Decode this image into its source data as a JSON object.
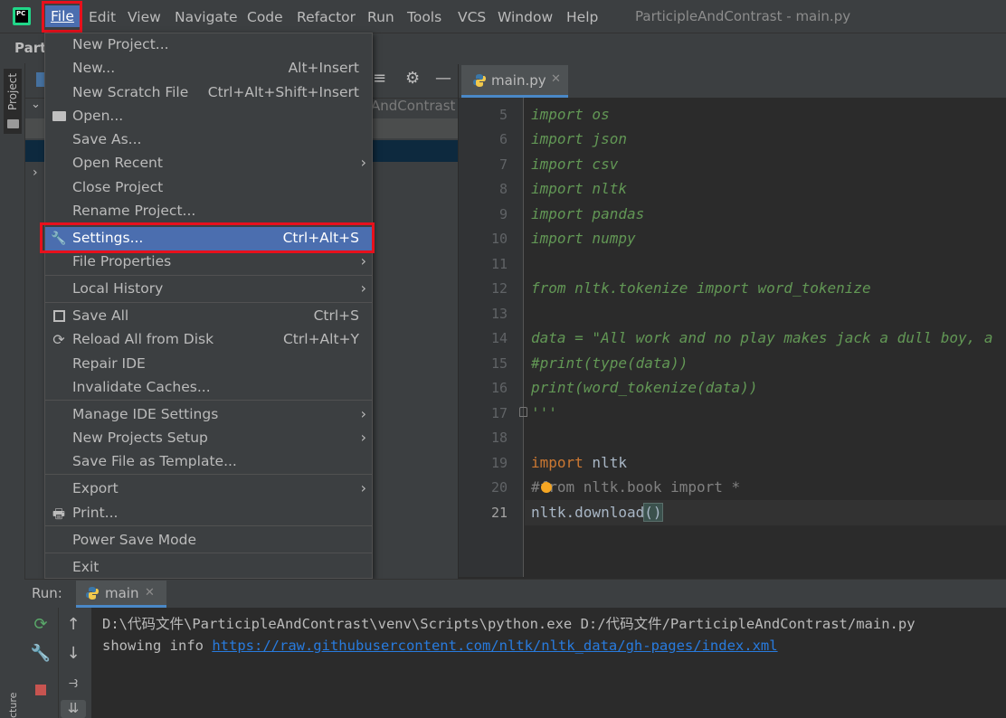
{
  "menubar": {
    "logo": "PC",
    "items": [
      "File",
      "Edit",
      "View",
      "Navigate",
      "Code",
      "Refactor",
      "Run",
      "Tools",
      "VCS",
      "Window",
      "Help"
    ],
    "window_title": "ParticipleAndContrast - main.py"
  },
  "navbar": {
    "project_name": "Parti"
  },
  "toolstripe": {
    "project_label": "Project",
    "structure_label": "cture"
  },
  "project_panel": {
    "path_fragment": "AndContrast"
  },
  "editor": {
    "tab_label": "main.py",
    "lines": [
      {
        "n": "5",
        "text": "import os"
      },
      {
        "n": "6",
        "text": "import json"
      },
      {
        "n": "7",
        "text": "import csv"
      },
      {
        "n": "8",
        "text": "import nltk"
      },
      {
        "n": "9",
        "text": "import pandas"
      },
      {
        "n": "10",
        "text": "import numpy"
      },
      {
        "n": "11",
        "text": ""
      },
      {
        "n": "12",
        "text": "from nltk.tokenize import word_tokenize"
      },
      {
        "n": "13",
        "text": ""
      },
      {
        "n": "14",
        "text": "data = \"All work and no play makes jack a dull boy, a"
      },
      {
        "n": "15",
        "text": "#print(type(data))"
      },
      {
        "n": "16",
        "text": "print(word_tokenize(data))"
      },
      {
        "n": "17",
        "text": "'''"
      },
      {
        "n": "18",
        "text": ""
      },
      {
        "n": "19",
        "text_kw": "import",
        "text_rest": " nltk"
      },
      {
        "n": "20",
        "text": "#from nltk.book import *"
      },
      {
        "n": "21",
        "text_main": "nltk.download",
        "text_paren": "()"
      }
    ]
  },
  "file_menu": {
    "items": [
      {
        "label": "New Project...",
        "shortcut": ""
      },
      {
        "label": "New...",
        "shortcut": "Alt+Insert"
      },
      {
        "label": "New Scratch File",
        "shortcut": "Ctrl+Alt+Shift+Insert"
      },
      {
        "label": "Open...",
        "shortcut": "",
        "icon": "folder-icon"
      },
      {
        "label": "Save As...",
        "shortcut": ""
      },
      {
        "label": "Open Recent",
        "shortcut": "",
        "submenu": true
      },
      {
        "label": "Close Project",
        "shortcut": ""
      },
      {
        "label": "Rename Project...",
        "shortcut": ""
      },
      {
        "label": "Settings...",
        "shortcut": "Ctrl+Alt+S",
        "icon": "wrench-icon",
        "selected": true
      },
      {
        "label": "File Properties",
        "shortcut": "",
        "submenu": true
      },
      {
        "label": "Local History",
        "shortcut": "",
        "submenu": true
      },
      {
        "label": "Save All",
        "shortcut": "Ctrl+S",
        "icon": "save-icon"
      },
      {
        "label": "Reload All from Disk",
        "shortcut": "Ctrl+Alt+Y",
        "icon": "reload-icon"
      },
      {
        "label": "Repair IDE",
        "shortcut": ""
      },
      {
        "label": "Invalidate Caches...",
        "shortcut": ""
      },
      {
        "label": "Manage IDE Settings",
        "shortcut": "",
        "submenu": true
      },
      {
        "label": "New Projects Setup",
        "shortcut": "",
        "submenu": true
      },
      {
        "label": "Save File as Template...",
        "shortcut": ""
      },
      {
        "label": "Export",
        "shortcut": "",
        "submenu": true
      },
      {
        "label": "Print...",
        "shortcut": "",
        "icon": "print-icon"
      },
      {
        "label": "Power Save Mode",
        "shortcut": ""
      },
      {
        "label": "Exit",
        "shortcut": ""
      }
    ]
  },
  "run_panel": {
    "label": "Run:",
    "tab_label": "main",
    "console": {
      "line1": "D:\\代码文件\\ParticipleAndContrast\\venv\\Scripts\\python.exe D:/代码文件/ParticipleAndContrast/main.py",
      "line2_prefix": "showing info ",
      "line2_link": "https://raw.githubusercontent.com/nltk/nltk_data/gh-pages/index.xml"
    }
  },
  "colors": {
    "accent": "#4b6eaf",
    "highlight_box": "#e8101c",
    "comment_green": "#629755",
    "keyword_orange": "#cc7832",
    "link_blue": "#287bde"
  }
}
